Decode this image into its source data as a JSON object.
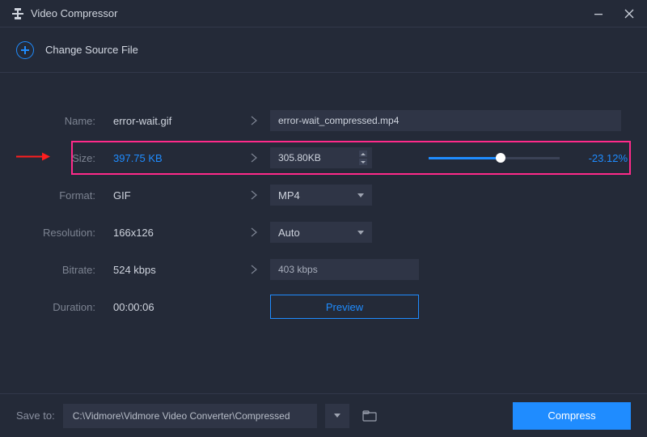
{
  "window": {
    "title": "Video Compressor"
  },
  "subbar": {
    "change_source": "Change Source File"
  },
  "labels": {
    "name": "Name:",
    "size": "Size:",
    "format": "Format:",
    "resolution": "Resolution:",
    "bitrate": "Bitrate:",
    "duration": "Duration:"
  },
  "source": {
    "name": "error-wait.gif",
    "size": "397.75 KB",
    "format": "GIF",
    "resolution": "166x126",
    "bitrate": "524 kbps",
    "duration": "00:00:06"
  },
  "target": {
    "name": "error-wait_compressed.mp4",
    "size": "305.80KB",
    "format": "MP4",
    "resolution": "Auto",
    "bitrate": "403 kbps"
  },
  "size_slider": {
    "percent_label": "-23.12%",
    "fill_pct": 55
  },
  "buttons": {
    "preview": "Preview",
    "compress": "Compress"
  },
  "footer": {
    "save_label": "Save to:",
    "path": "C:\\Vidmore\\Vidmore Video Converter\\Compressed"
  }
}
